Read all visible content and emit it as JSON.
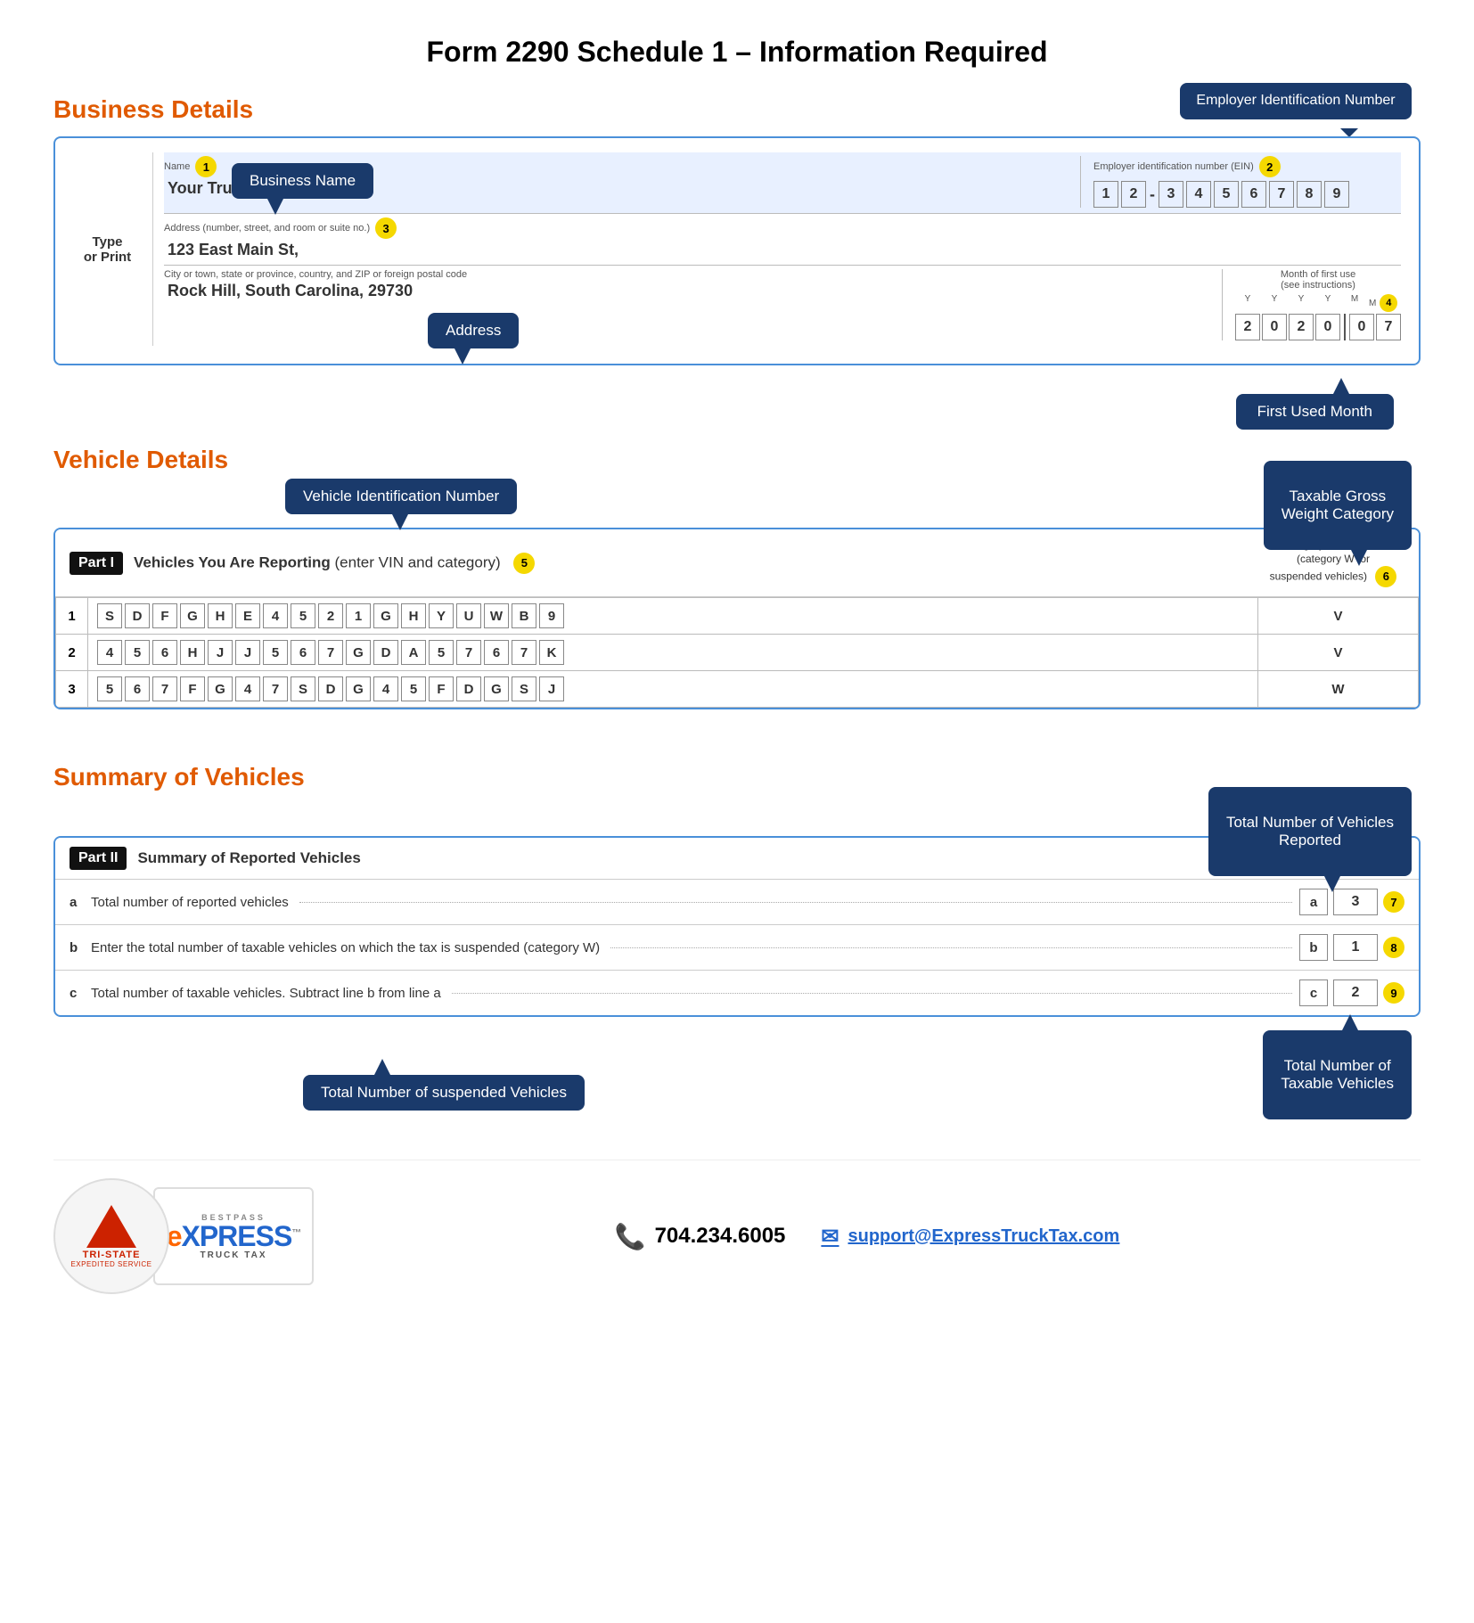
{
  "page": {
    "title": "Form 2290 Schedule 1 – Information Required"
  },
  "business_section": {
    "title": "Business Details",
    "callouts": {
      "business_name": "Business Name",
      "ein": "Employer Identification Number",
      "address": "Address",
      "first_used_month": "First Used Month"
    },
    "form": {
      "type_or_print": "Type\nor Print",
      "name_label": "Name",
      "name_num": "1",
      "name_value": "Your Trucking Business",
      "ein_label": "Employer identification number (EIN)",
      "ein_num": "2",
      "ein_digits": [
        "1",
        "2",
        "-",
        "3",
        "4",
        "5",
        "6",
        "7",
        "8",
        "9"
      ],
      "address_label": "Address (number, street, and room or suite no.)",
      "address_num": "3",
      "address_value": "123 East Main St,",
      "city_label": "City or town, state or province, country, and ZIP or foreign postal code",
      "city_value": "Rock Hill, South Carolina, 29730",
      "month_label": "Month of first use\n(see instructions)",
      "month_num": "4",
      "month_year_headers": [
        "Y",
        "Y",
        "Y",
        "Y",
        "M",
        "M"
      ],
      "month_digits": [
        "2",
        "0",
        "2",
        "0",
        "0",
        "7"
      ]
    }
  },
  "vehicle_section": {
    "title": "Vehicle Details",
    "callouts": {
      "vin": "Vehicle Identification Number",
      "tgw": "Taxable Gross\nWeight Category"
    },
    "form": {
      "part_label": "Part I",
      "part_title": "Vehicles You Are Reporting",
      "part_subtitle": "(enter VIN and category)",
      "part_num": "5",
      "category_header": "Category A through W\n(category W for\nsuspended vehicles)",
      "category_num": "6",
      "vehicles": [
        {
          "row": "1",
          "vin": [
            "S",
            "D",
            "F",
            "G",
            "H",
            "E",
            "4",
            "5",
            "2",
            "1",
            "G",
            "H",
            "Y",
            "U",
            "W",
            "B",
            "9"
          ],
          "category": "V"
        },
        {
          "row": "2",
          "vin": [
            "4",
            "5",
            "6",
            "H",
            "J",
            "J",
            "5",
            "6",
            "7",
            "G",
            "D",
            "A",
            "5",
            "7",
            "6",
            "7",
            "K"
          ],
          "category": "V"
        },
        {
          "row": "3",
          "vin": [
            "5",
            "6",
            "7",
            "F",
            "G",
            "4",
            "7",
            "S",
            "D",
            "G",
            "4",
            "5",
            "F",
            "D",
            "G",
            "S",
            "J"
          ],
          "category": "W"
        }
      ]
    }
  },
  "summary_section": {
    "title": "Summary of Vehicles",
    "callouts": {
      "reported": "Total Number of Vehicles\nReported",
      "suspended": "Total Number of suspended Vehicles",
      "taxable": "Total Number of\nTaxable Vehicles"
    },
    "form": {
      "part_label": "Part II",
      "part_title": "Summary of Reported Vehicles",
      "rows": [
        {
          "letter": "a",
          "text": "Total number of reported vehicles",
          "row_letter": "a",
          "value": "3",
          "num": "7"
        },
        {
          "letter": "b",
          "text": "Enter the total number of taxable vehicles on which the tax is suspended (category W)",
          "row_letter": "b",
          "value": "1",
          "num": "8"
        },
        {
          "letter": "c",
          "text": "Total number of taxable vehicles. Subtract line b from line a",
          "row_letter": "c",
          "value": "2",
          "num": "9"
        }
      ]
    }
  },
  "footer": {
    "tristate_name": "TRI-STATE",
    "tristate_sub": "EXPEDITED SERVICE",
    "express_bestpass": "BESTPASS",
    "express_main": "eXPRESS",
    "express_sub": "TRUCK TAX",
    "phone": "704.234.6005",
    "email": "support@ExpressTruckTax.com"
  }
}
